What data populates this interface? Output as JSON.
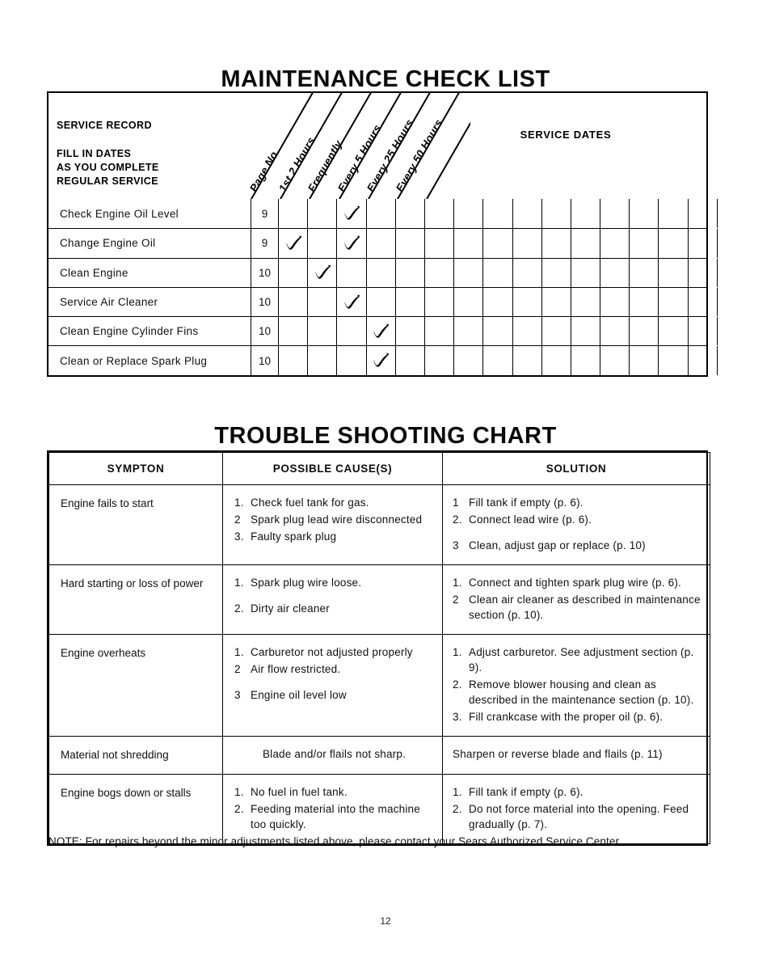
{
  "document": {
    "page_number": "12",
    "note": "NOTE: For repairs beyond the minor adjustments listed above, please contact your Sears Authorized Service Center."
  },
  "maintenance": {
    "title": "MAINTENANCE CHECK LIST",
    "corner_heading_line1": "SERVICE RECORD",
    "corner_heading_line2": "FILL IN DATES",
    "corner_heading_line3": "AS YOU COMPLETE",
    "corner_heading_line4": "REGULAR SERVICE",
    "service_dates_label": "SERVICE DATES",
    "diagonal_columns": [
      "Page No.",
      "1st 2 Hours",
      "Frequently",
      "Every 5 Hours",
      "Every 25 Hours",
      "Every 50 Hours"
    ],
    "schedule_columns": [
      "1st 2 Hours",
      "Frequently",
      "Every 5 Hours",
      "Every 25 Hours",
      "Every 50 Hours"
    ],
    "service_date_column_count": 11,
    "rows": [
      {
        "task": "Check Engine Oil Level",
        "page": "9",
        "checks": [
          false,
          false,
          true,
          false,
          false
        ]
      },
      {
        "task": "Change Engine Oil",
        "page": "9",
        "checks": [
          true,
          false,
          true,
          false,
          false
        ]
      },
      {
        "task": "Clean Engine",
        "page": "10",
        "checks": [
          false,
          true,
          false,
          false,
          false
        ]
      },
      {
        "task": "Service Air Cleaner",
        "page": "10",
        "checks": [
          false,
          false,
          true,
          false,
          false
        ]
      },
      {
        "task": "Clean Engine Cylinder Fins",
        "page": "10",
        "checks": [
          false,
          false,
          false,
          true,
          false
        ]
      },
      {
        "task": "Clean or Replace Spark Plug",
        "page": "10",
        "checks": [
          false,
          false,
          false,
          true,
          false
        ]
      }
    ]
  },
  "troubleshooting": {
    "title": "TROUBLE SHOOTING CHART",
    "headers": {
      "symptom": "SYMPTON",
      "cause": "POSSIBLE CAUSE(S)",
      "solution": "SOLUTION"
    },
    "rows": [
      {
        "symptom": "Engine fails to start",
        "causes": [
          {
            "num": "1.",
            "text": "Check fuel tank for gas."
          },
          {
            "num": "2",
            "text": "Spark plug lead wire disconnected"
          },
          {
            "num": "3.",
            "text": "Faulty spark plug"
          }
        ],
        "solutions": [
          {
            "num": "1",
            "text": "Fill tank if empty (p. 6)."
          },
          {
            "num": "2.",
            "text": "Connect lead wire (p. 6)."
          },
          {
            "num": "3",
            "text": "Clean, adjust gap or replace (p. 10)"
          }
        ]
      },
      {
        "symptom": "Hard starting or loss of power",
        "causes": [
          {
            "num": "1.",
            "text": "Spark plug wire loose."
          },
          {
            "num": "2.",
            "text": "Dirty air cleaner"
          }
        ],
        "solutions": [
          {
            "num": "1.",
            "text": "Connect and tighten spark plug wire (p. 6)."
          },
          {
            "num": "2",
            "text": "Clean air cleaner as described in maintenance section (p. 10)."
          }
        ]
      },
      {
        "symptom": "Engine overheats",
        "causes": [
          {
            "num": "1.",
            "text": "Carburetor not adjusted properly"
          },
          {
            "num": "2",
            "text": "Air flow restricted."
          },
          {
            "num": "3",
            "text": "Engine oil level low"
          }
        ],
        "solutions": [
          {
            "num": "1.",
            "text": "Adjust carburetor. See adjustment section (p. 9)."
          },
          {
            "num": "2.",
            "text": "Remove blower housing and clean as described in the maintenance section (p. 10)."
          },
          {
            "num": "3.",
            "text": "Fill crankcase with the proper oil (p. 6)."
          }
        ]
      },
      {
        "symptom": "Material not shredding",
        "cause_plain": "Blade and/or flails not sharp.",
        "solution_plain": "Sharpen or reverse blade and flails (p. 11)"
      },
      {
        "symptom": "Engine bogs down or stalls",
        "causes": [
          {
            "num": "1.",
            "text": "No fuel in fuel tank."
          },
          {
            "num": "2.",
            "text": "Feeding material into the machine too quickly."
          }
        ],
        "solutions": [
          {
            "num": "1.",
            "text": "Fill tank if empty (p. 6)."
          },
          {
            "num": "2.",
            "text": "Do not force material into the opening. Feed gradually (p. 7)."
          }
        ]
      }
    ]
  }
}
